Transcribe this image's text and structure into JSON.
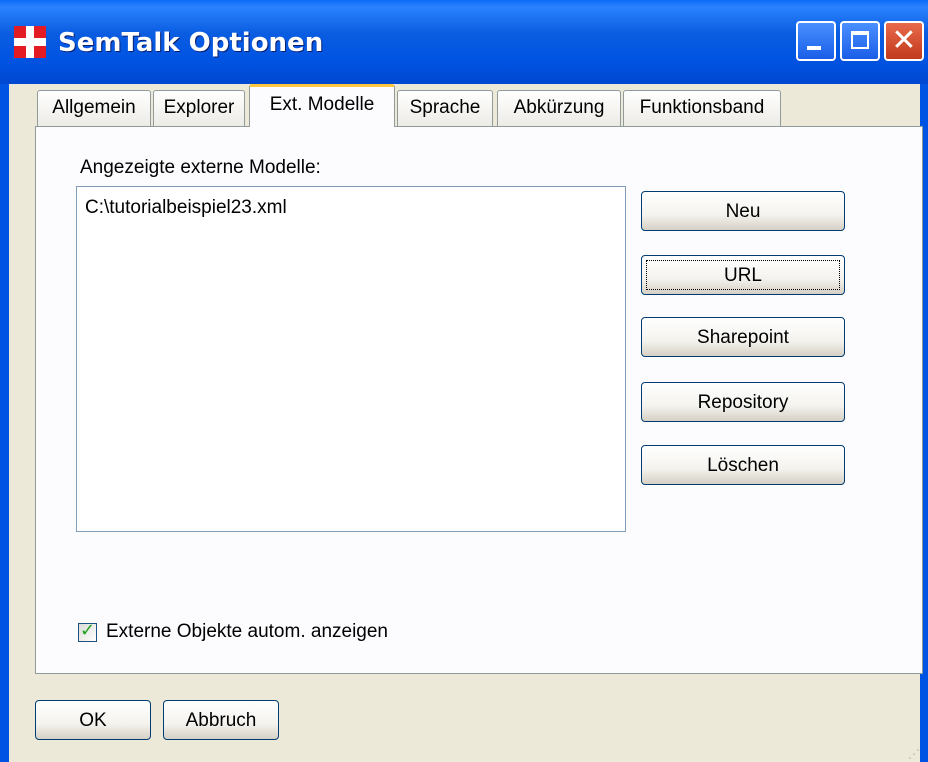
{
  "window": {
    "title": "SemTalk Optionen",
    "controls": {
      "minimize_icon": "minimize-icon",
      "maximize_icon": "maximize-icon",
      "close_icon": "close-icon"
    }
  },
  "tabs": [
    {
      "label": "Allgemein"
    },
    {
      "label": "Explorer"
    },
    {
      "label": "Ext. Modelle",
      "active": true
    },
    {
      "label": "Sprache"
    },
    {
      "label": "Abkürzung"
    },
    {
      "label": "Funktionsband"
    }
  ],
  "ext_models": {
    "list_label": "Angezeigte externe Modelle:",
    "items": [
      "C:\\tutorialbeispiel23.xml"
    ],
    "buttons": {
      "new": "Neu",
      "url": "URL",
      "sharepoint": "Sharepoint",
      "repository": "Repository",
      "delete": "Löschen"
    },
    "auto_show_checkbox": {
      "label": "Externe Objekte autom. anzeigen",
      "checked": true
    }
  },
  "footer": {
    "ok": "OK",
    "cancel": "Abbruch"
  },
  "colors": {
    "titlebar": "#0054e3",
    "dialog_bg": "#ece9d8",
    "active_tab_accent": "#ffc83c"
  }
}
